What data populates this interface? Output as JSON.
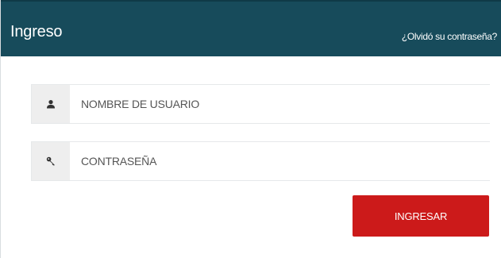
{
  "panel": {
    "title": "Ingreso",
    "forgot_link": "¿Olvidó su contraseña?"
  },
  "form": {
    "username": {
      "placeholder": "NOMBRE DE USUARIO",
      "icon": "user-icon"
    },
    "password": {
      "placeholder": "CONTRASEÑA",
      "icon": "key-icon"
    },
    "submit_label": "INGRESAR"
  },
  "colors": {
    "header_bg": "#174b5b",
    "submit_bg": "#cc1a1a",
    "addon_bg": "#eeeeee"
  }
}
